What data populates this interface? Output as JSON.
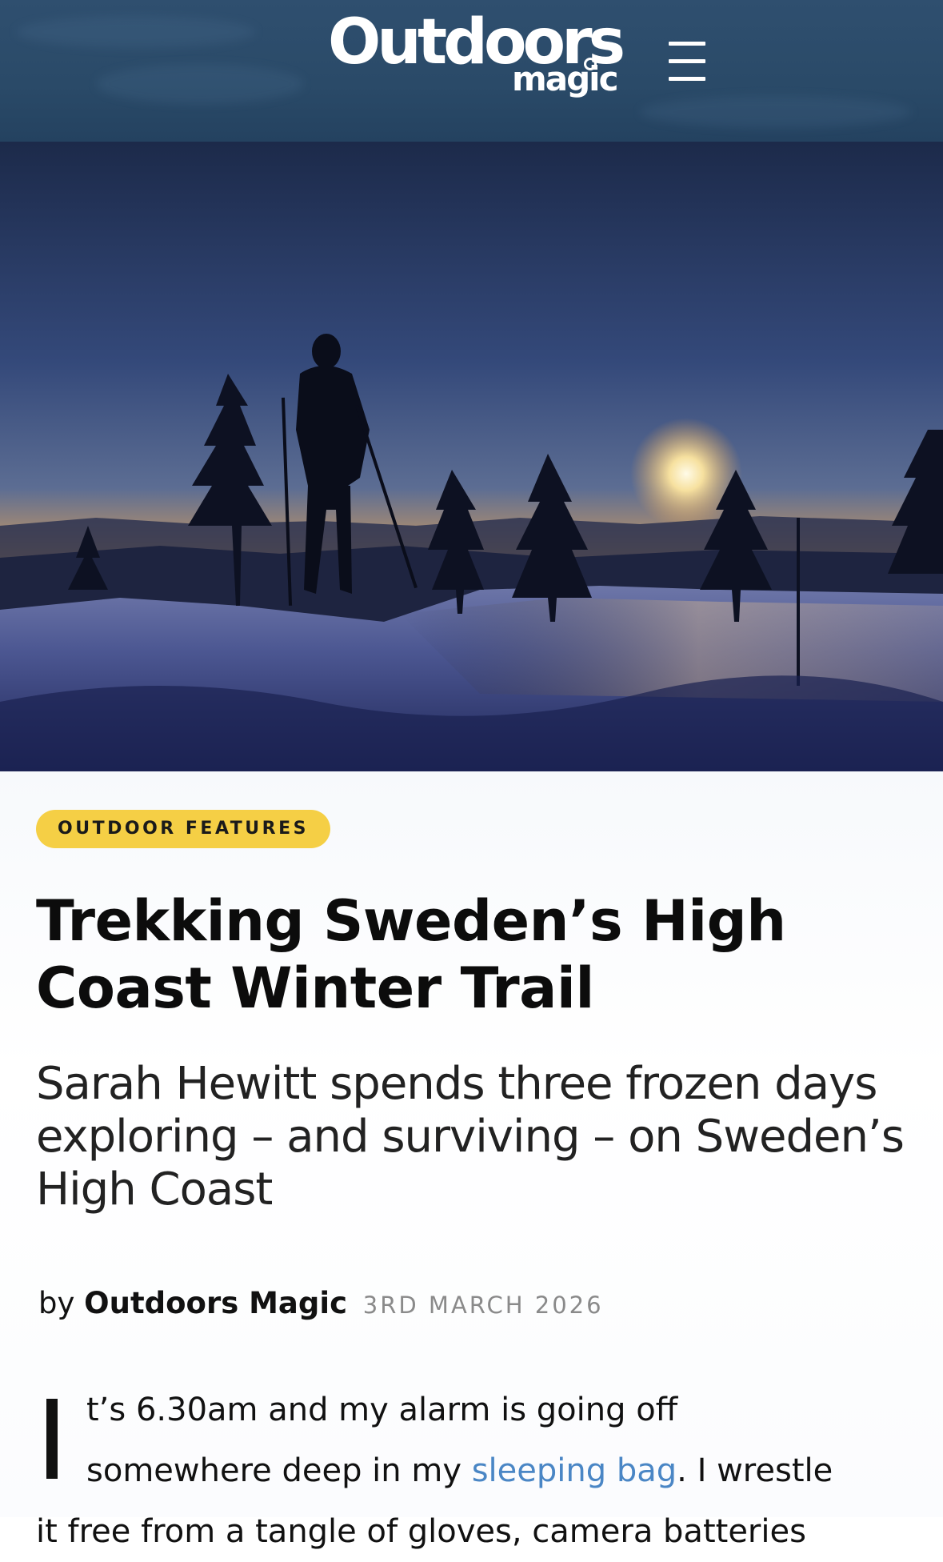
{
  "header": {
    "logo_main": "Outdoors",
    "logo_sub": "magic",
    "menu_icon": "hamburger-menu-icon",
    "background": "#2c4b6b"
  },
  "hero": {
    "image_description_icon": "hero-photo"
  },
  "article": {
    "category": "OUTDOOR FEATURES",
    "category_color": "#f5cf45",
    "title": "Trekking Sweden’s High Coast Winter Trail",
    "standfirst": "Sarah Hewitt spends three frozen days exploring – and surviving – on Sweden’s High Coast",
    "byline_prefix": "by",
    "author": "Outdoors Magic",
    "date": "3RD MARCH 2026",
    "dropcap": "I",
    "body_line1": "t’s 6.30am and my alarm is going off",
    "body_line2_before": "somewhere deep in my ",
    "body_link": "sleeping bag",
    "body_line2_after": ". I wrestle",
    "body_line3": "it free from a tangle of gloves, camera batteries",
    "link_color": "#4a86c5"
  }
}
